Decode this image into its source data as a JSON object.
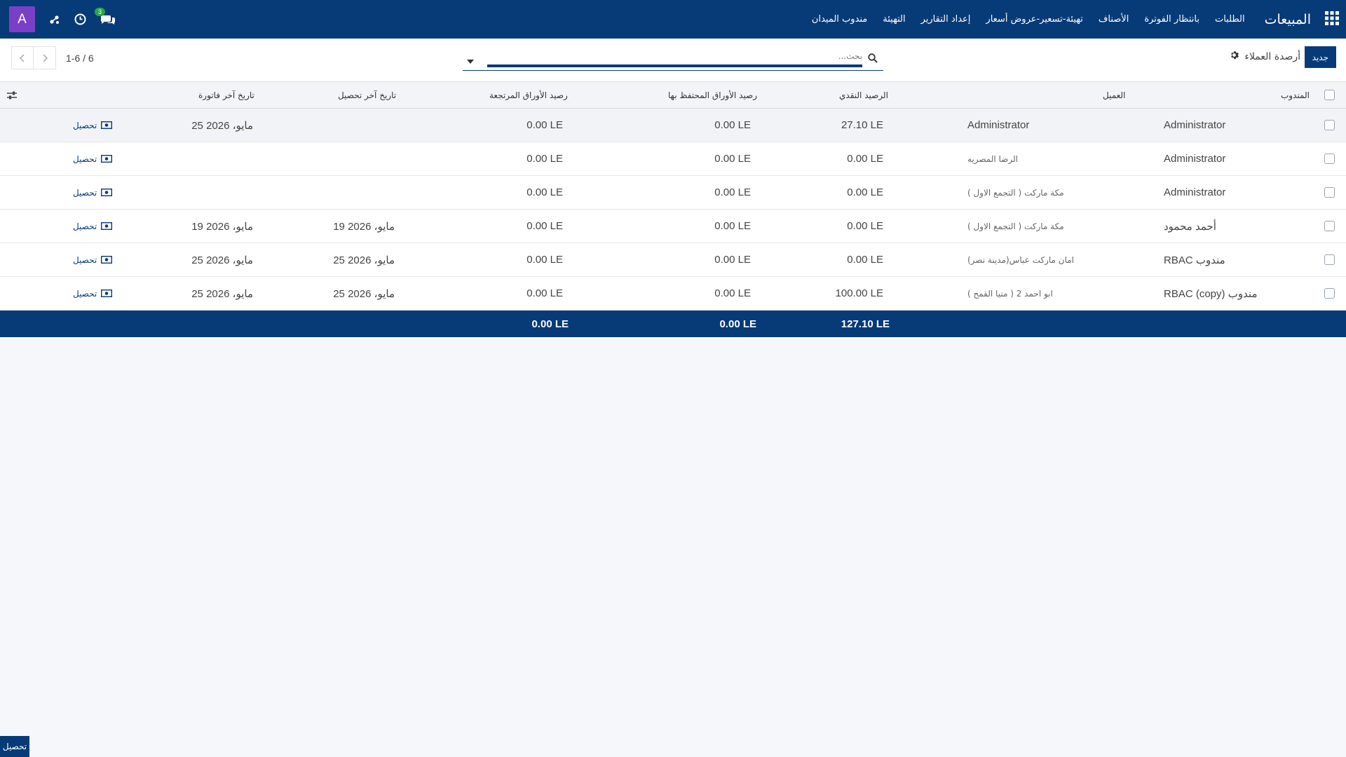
{
  "navbar": {
    "brand": "المبيعات",
    "menu": [
      "الطلبات",
      "بانتظار الفوترة",
      "الأصناف",
      "تهيئة-تسعير-عروض أسعار",
      "إعداد التقارير",
      "التهيئة",
      "مندوب الميدان"
    ],
    "avatar_letter": "A",
    "chat_badge": "3"
  },
  "control": {
    "new_button": "جديد",
    "view_title": "أرصدة العملاء",
    "search_placeholder": "بحث...",
    "pager_text": "1-6 / 6"
  },
  "table": {
    "headers": {
      "salesperson": "المندوب",
      "customer": "العميل",
      "cash_balance": "الرصيد النقدي",
      "held_papers": "رصيد الأوراق المحتفظ بها",
      "returned_papers": "رصيد الأوراق المرتجعة",
      "last_collection": "تاريخ آخر تحصيل",
      "last_invoice": "تاريخ آخر فاتورة"
    },
    "rows": [
      {
        "salesperson": "Administrator",
        "customer": "Administrator",
        "cash": "27.10 LE",
        "held": "0.00 LE",
        "returned": "0.00 LE",
        "last_collection": "",
        "last_invoice": "25 مايو، 2026",
        "action": "تحصيل"
      },
      {
        "salesperson": "Administrator",
        "customer": "الرضا المصريه",
        "cash": "0.00 LE",
        "held": "0.00 LE",
        "returned": "0.00 LE",
        "last_collection": "",
        "last_invoice": "",
        "action": "تحصيل"
      },
      {
        "salesperson": "Administrator",
        "customer": "مكة ماركت ( التجمع الاول )",
        "cash": "0.00 LE",
        "held": "0.00 LE",
        "returned": "0.00 LE",
        "last_collection": "",
        "last_invoice": "",
        "action": "تحصيل"
      },
      {
        "salesperson": "أحمد محمود",
        "customer": "مكة ماركت ( التجمع الاول )",
        "cash": "0.00 LE",
        "held": "0.00 LE",
        "returned": "0.00 LE",
        "last_collection": "19 مايو، 2026",
        "last_invoice": "19 مايو، 2026",
        "action": "تحصيل"
      },
      {
        "salesperson": "مندوب RBAC",
        "customer": "امان ماركت عباس(مدينة نصر)",
        "cash": "0.00 LE",
        "held": "0.00 LE",
        "returned": "0.00 LE",
        "last_collection": "25 مايو، 2026",
        "last_invoice": "25 مايو، 2026",
        "action": "تحصيل"
      },
      {
        "salesperson": "مندوب RBAC (copy)",
        "customer": "ابو احمد 2 ( منيا القمح )",
        "cash": "100.00 LE",
        "held": "0.00 LE",
        "returned": "0.00 LE",
        "last_collection": "25 مايو، 2026",
        "last_invoice": "25 مايو، 2026",
        "action": "تحصيل"
      }
    ],
    "totals": {
      "cash": "127.10 LE",
      "held": "0.00 LE",
      "returned": "0.00 LE"
    }
  },
  "bottom_button": "تحصيل"
}
